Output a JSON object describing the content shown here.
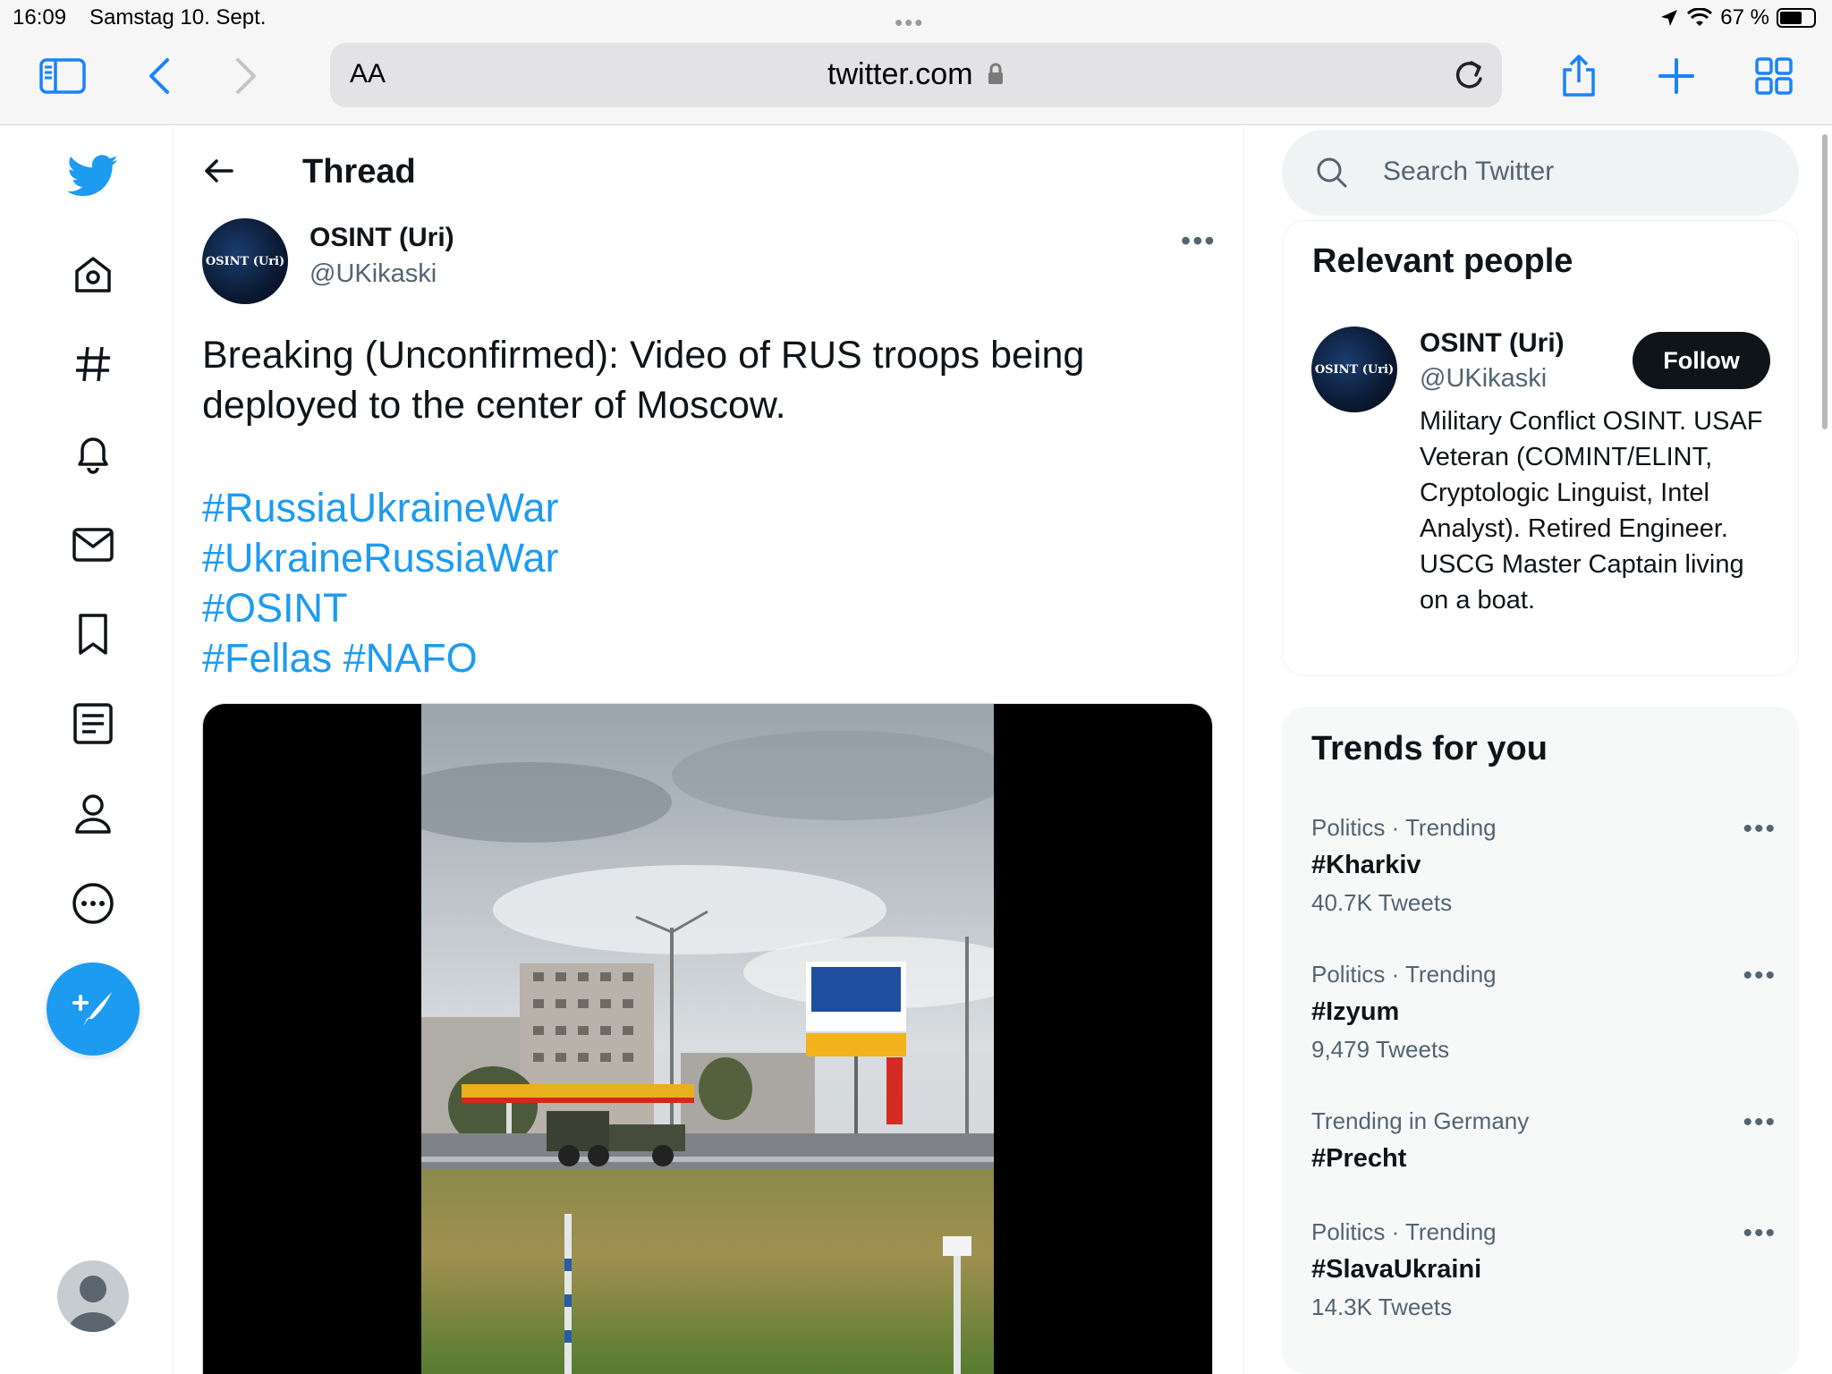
{
  "status_bar": {
    "time": "16:09",
    "date": "Samstag 10. Sept.",
    "battery": "67 %",
    "battery_level": 0.67
  },
  "browser": {
    "text_size_label": "AA",
    "url": "twitter.com"
  },
  "thread": {
    "title": "Thread",
    "author_name": "OSINT (Uri)",
    "author_handle": "@UKikaski",
    "avatar_text": "OSINT (Uri)",
    "text": "Breaking (Unconfirmed): Video of RUS troops being deployed to the center of Moscow.",
    "hashtags": [
      "#RussiaUkraineWar",
      "#UkraineRussiaWar",
      "#OSINT",
      "#Fellas #NAFO"
    ]
  },
  "search": {
    "placeholder": "Search Twitter"
  },
  "relevant_people": {
    "title": "Relevant people",
    "name": "OSINT (Uri)",
    "handle": "@UKikaski",
    "avatar_text": "OSINT (Uri)",
    "follow_label": "Follow",
    "bio": "Military Conflict OSINT. USAF Veteran (COMINT/ELINT, Cryptologic Linguist, Intel Analyst). Retired Engineer. USCG Master Captain living on a boat."
  },
  "trends": {
    "title": "Trends for you",
    "items": [
      {
        "category": "Politics · Trending",
        "name": "#Kharkiv",
        "count": "40.7K Tweets"
      },
      {
        "category": "Politics · Trending",
        "name": "#Izyum",
        "count": "9,479 Tweets"
      },
      {
        "category": "Trending in Germany",
        "name": "#Precht",
        "count": ""
      },
      {
        "category": "Politics · Trending",
        "name": "#SlavaUkraini",
        "count": "14.3K Tweets"
      }
    ]
  },
  "colors": {
    "twitter_blue": "#1d9bf0",
    "safari_blue": "#1a82fb",
    "text_primary": "#0f1419",
    "text_secondary": "#536471"
  },
  "icons": [
    "sidebar-icon",
    "back-icon",
    "forward-icon",
    "lock-icon",
    "reload-icon",
    "share-icon",
    "plus-icon",
    "tabs-icon",
    "twitter-logo-icon",
    "home-icon",
    "hashtag-icon",
    "bell-icon",
    "mail-icon",
    "bookmark-icon",
    "list-icon",
    "profile-icon",
    "more-circle-icon",
    "compose-icon",
    "search-icon",
    "more-dots-icon"
  ]
}
